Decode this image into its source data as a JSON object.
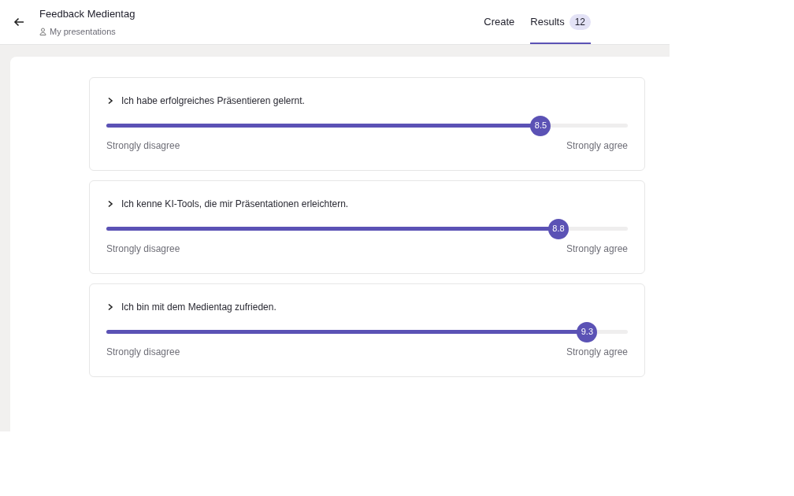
{
  "header": {
    "title": "Feedback Medientag",
    "breadcrumb": "My presentations"
  },
  "tabs": [
    {
      "label": "Create",
      "selected": false
    },
    {
      "label": "Results",
      "selected": true,
      "badge": "12"
    }
  ],
  "questions": [
    {
      "text": "Ich habe erfolgreiches Präsentieren gelernt.",
      "level": 0.833,
      "reading": "8.5",
      "min_label": "Strongly disagree",
      "max_label": "Strongly agree"
    },
    {
      "text": "Ich kenne KI-Tools, die mir Präsentationen erleichtern.",
      "level": 0.867,
      "reading": "8.8",
      "min_label": "Strongly disagree",
      "max_label": "Strongly agree"
    },
    {
      "text": "Ich bin mit dem Medientag zufrieden.",
      "level": 0.922,
      "reading": "9.3",
      "min_label": "Strongly disagree",
      "max_label": "Strongly agree"
    }
  ]
}
